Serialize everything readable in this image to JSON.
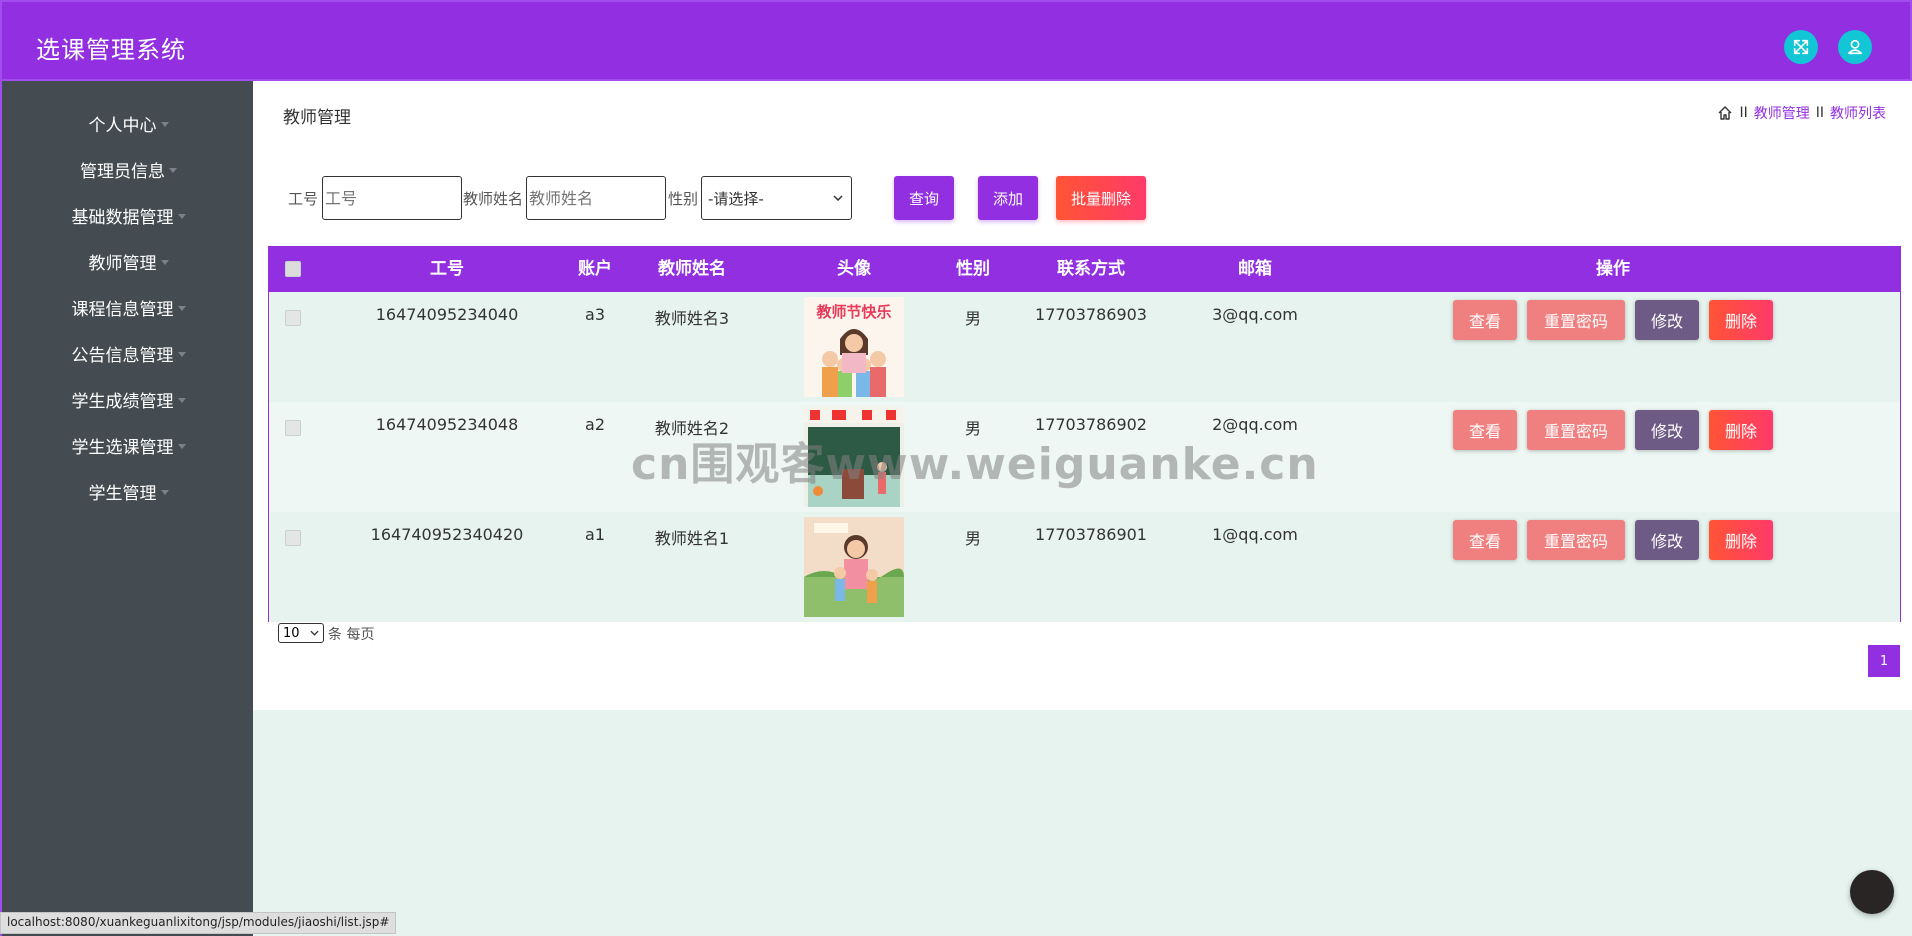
{
  "app": {
    "title": "选课管理系统"
  },
  "header": {
    "fullscreen_icon": "expand-arrows-icon",
    "user_icon": "user-icon"
  },
  "sidebar": {
    "items": [
      {
        "label": "个人中心"
      },
      {
        "label": "管理员信息"
      },
      {
        "label": "基础数据管理"
      },
      {
        "label": "教师管理"
      },
      {
        "label": "课程信息管理"
      },
      {
        "label": "公告信息管理"
      },
      {
        "label": "学生成绩管理"
      },
      {
        "label": "学生选课管理"
      },
      {
        "label": "学生管理"
      }
    ]
  },
  "page": {
    "title": "教师管理",
    "breadcrumb": {
      "sep": "II",
      "level1": "教师管理",
      "level2": "教师列表"
    }
  },
  "filters": {
    "id_label": "工号",
    "id_placeholder": "工号",
    "name_label": "教师姓名",
    "name_placeholder": "教师姓名",
    "gender_label": "性别",
    "gender_selected": "-请选择-",
    "query_btn": "查询",
    "add_btn": "添加",
    "batch_delete_btn": "批量删除"
  },
  "table": {
    "headers": [
      "工号",
      "账户",
      "教师姓名",
      "头像",
      "性别",
      "联系方式",
      "邮箱",
      "操作"
    ],
    "rows": [
      {
        "id": "16474095234040",
        "account": "a3",
        "name": "教师姓名3",
        "avatar": "avatar-teachers-day",
        "gender": "男",
        "phone": "17703786903",
        "email": "3@qq.com"
      },
      {
        "id": "16474095234048",
        "account": "a2",
        "name": "教师姓名2",
        "avatar": "avatar-classroom",
        "gender": "男",
        "phone": "17703786902",
        "email": "2@qq.com"
      },
      {
        "id": "164740952340420",
        "account": "a1",
        "name": "教师姓名1",
        "avatar": "avatar-teacher-kids",
        "gender": "男",
        "phone": "17703786901",
        "email": "1@qq.com"
      }
    ],
    "actions": {
      "view": "查看",
      "reset": "重置密码",
      "edit": "修改",
      "delete": "删除"
    }
  },
  "pagination": {
    "page_size": "10",
    "suffix": "条 每页",
    "current_page": "1"
  },
  "watermark": "cn围观客www.weiguanke.cn",
  "status_bar": "localhost:8080/xuankeguanlixitong/jsp/modules/jiaoshi/list.jsp#",
  "colors": {
    "primary": "#912fe1",
    "sidebar": "#444c51",
    "accent_cyan": "#12c6d6",
    "danger": "#ff3a6a",
    "pink": "#f08080",
    "muted_purple": "#6e5b85"
  }
}
